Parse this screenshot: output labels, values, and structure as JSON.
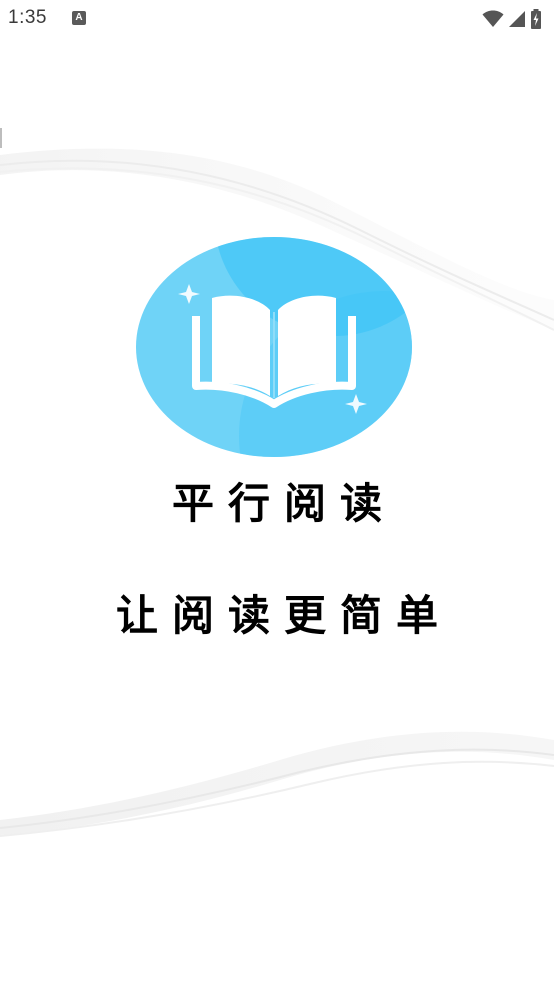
{
  "status_bar": {
    "time": "1:35",
    "notification_glyph": "A",
    "icons": [
      "wifi-icon",
      "cellular-signal-icon",
      "battery-charging-icon"
    ]
  },
  "splash": {
    "app_name": "平行阅读",
    "slogan": "让阅读更简单",
    "logo_icon": "open-book-icon",
    "colors": {
      "logo_light": "#6fd3f7",
      "logo_dark": "#38c3f7",
      "text": "#000000",
      "wave": "#e9e9e9"
    }
  }
}
